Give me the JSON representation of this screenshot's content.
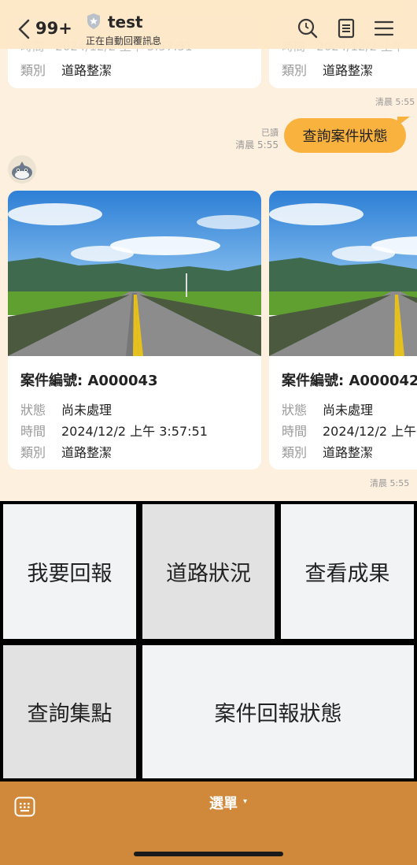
{
  "header": {
    "back_count": "99+",
    "title": "test",
    "subtitle": "正在自動回覆訊息"
  },
  "messages": {
    "prev_cards": [
      {
        "label_cat": "類別",
        "value_cat": "道路整潔"
      },
      {
        "label_cat": "類別",
        "value_cat": "道路整潔"
      }
    ],
    "prev_time": "清晨 5:55",
    "sent": {
      "read": "已讀",
      "time": "清晨 5:55",
      "text": "查詢案件狀態"
    },
    "cards": [
      {
        "case_no": "案件編號: A000043",
        "status_label": "狀態",
        "status": "尚未處理",
        "time_label": "時間",
        "time": "2024/12/2 上午 3:57:51",
        "cat_label": "類別",
        "cat": "道路整潔"
      },
      {
        "case_no": "案件編號: A000042",
        "status_label": "狀態",
        "status": "尚未處理",
        "time_label": "時間",
        "time": "2024/12/2 上午",
        "cat_label": "類別",
        "cat": "道路整潔"
      }
    ],
    "cards_time": "清晨 5:55"
  },
  "rich_menu": {
    "report": "我要回報",
    "road_status": "道路狀況",
    "results": "查看成果",
    "points": "查詢集點",
    "case_status": "案件回報狀態"
  },
  "bottom": {
    "menu_label": "選單",
    "caret": "▾"
  },
  "colors": {
    "header_bg": "#fde8c8",
    "chat_bg": "#fdf0de",
    "bubble": "#f9b23d",
    "bottom_bar": "#d0883a"
  }
}
